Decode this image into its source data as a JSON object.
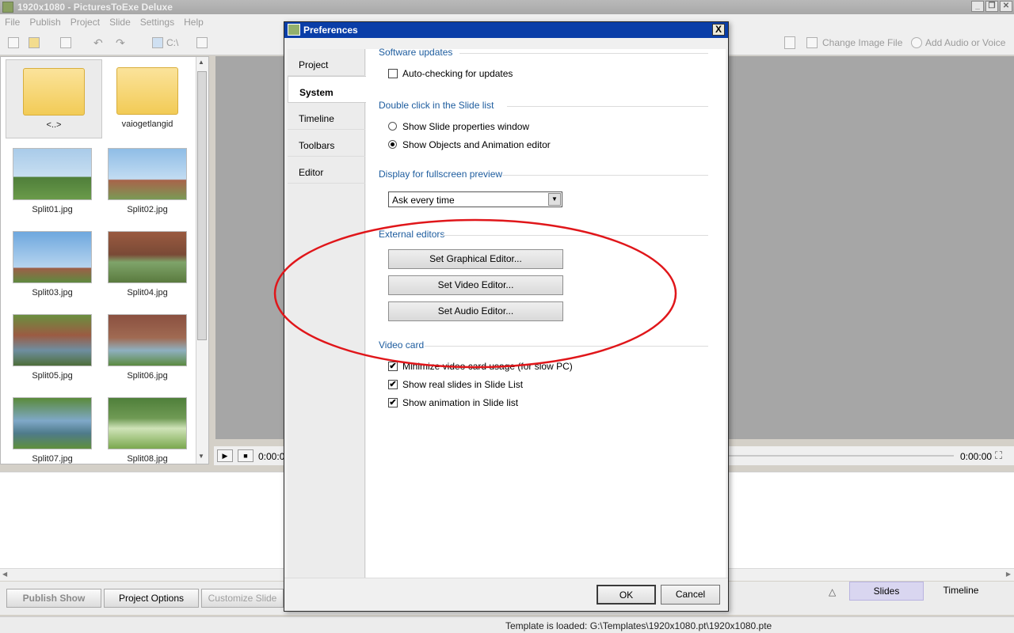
{
  "app": {
    "title": "1920x1080 - PicturesToExe Deluxe",
    "menu": [
      "File",
      "Publish",
      "Project",
      "Slide",
      "Settings",
      "Help"
    ],
    "toolbar": {
      "drive_label": "C:\\",
      "change_image": "Change Image File",
      "add_audio": "Add Audio or Voice"
    },
    "files": [
      {
        "name": "<..>",
        "kind": "parent-folder"
      },
      {
        "name": "vaiogetlangid",
        "kind": "folder"
      },
      {
        "name": "Split01.jpg",
        "kind": "image"
      },
      {
        "name": "Split02.jpg",
        "kind": "image"
      },
      {
        "name": "Split03.jpg",
        "kind": "image"
      },
      {
        "name": "Split04.jpg",
        "kind": "image"
      },
      {
        "name": "Split05.jpg",
        "kind": "image"
      },
      {
        "name": "Split06.jpg",
        "kind": "image"
      },
      {
        "name": "Split07.jpg",
        "kind": "image"
      },
      {
        "name": "Split08.jpg",
        "kind": "image"
      }
    ],
    "playbar": {
      "time_left": "0:00:0",
      "time_right": "0:00:00"
    },
    "bottom_buttons": {
      "publish": "Publish Show",
      "project_options": "Project Options",
      "customize_slide": "Customize Slide"
    },
    "view_tabs": {
      "arrow": "△",
      "slides": "Slides",
      "timeline": "Timeline"
    },
    "status": "Template is loaded: G:\\Templates\\1920x1080.pt\\1920x1080.pte"
  },
  "dialog": {
    "title": "Preferences",
    "close": "X",
    "tabs": [
      "Project",
      "System",
      "Timeline",
      "Toolbars",
      "Editor"
    ],
    "active_tab": "System",
    "sections": {
      "software_updates": {
        "heading": "Software updates",
        "auto_check": "Auto-checking for updates",
        "auto_check_checked": false
      },
      "double_click": {
        "heading": "Double click in the Slide list",
        "opt1": "Show Slide properties window",
        "opt2": "Show Objects and Animation editor",
        "selected": "opt2"
      },
      "fullscreen": {
        "heading": "Display for fullscreen preview",
        "value": "Ask every time"
      },
      "external_editors": {
        "heading": "External editors",
        "graphical": "Set Graphical Editor...",
        "video": "Set Video Editor...",
        "audio": "Set Audio Editor..."
      },
      "video_card": {
        "heading": "Video card",
        "minimize": "Minimize video card usage (for slow PC)",
        "real_slides": "Show real slides in Slide List",
        "animation": "Show animation in Slide list",
        "minimize_checked": true,
        "real_slides_checked": true,
        "animation_checked": true
      }
    },
    "ok": "OK",
    "cancel": "Cancel",
    "check_mark": "✔"
  },
  "colors": {
    "annotation": "#e0161a",
    "section_heading": "#1d5c9e",
    "dialog_title": "#0a3ea8"
  }
}
